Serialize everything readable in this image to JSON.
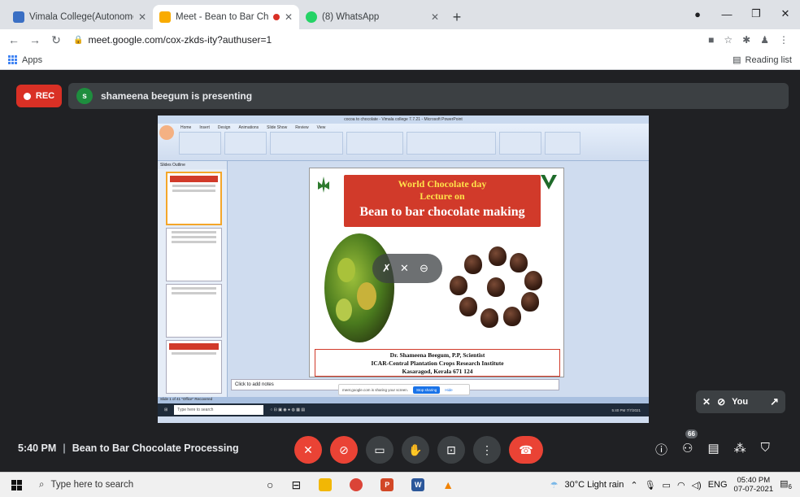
{
  "browser": {
    "tabs": [
      {
        "title": "Vimala College(Autonomous) - C",
        "favicon_color": "#3a6fc4",
        "active": false
      },
      {
        "title": "Meet - Bean to Bar Chocolat",
        "favicon_color": "#f9ab00",
        "active": true
      },
      {
        "title": "(8) WhatsApp",
        "favicon_color": "#25d366",
        "active": false
      }
    ],
    "url": "meet.google.com/cox-zkds-ity?authuser=1",
    "bookmarks": {
      "apps_label": "Apps",
      "reading_list_label": "Reading list"
    }
  },
  "meet": {
    "rec_label": "REC",
    "presenter_initial": "s",
    "presenting_text": "shameena beegum is presenting",
    "self_label": "You",
    "meeting_time": "5:40 PM",
    "meeting_title": "Bean to Bar Chocolate Processing",
    "people_count": "66"
  },
  "shared_screen": {
    "ppt_window_title": "cocoa to chocolate - Vimala college 7.7.21 - Microsoft PowerPoint",
    "ribbon_menu": [
      "Home",
      "Insert",
      "Design",
      "Animations",
      "Slide Show",
      "Review",
      "View"
    ],
    "slides_tabs": "Slides  Outline",
    "slide": {
      "line1": "World Chocolate day",
      "line2": "Lecture on",
      "line3": "Bean to bar chocolate making",
      "credit1": "Dr. Shameena Beegum, P.P, Scientist",
      "credit2": "ICAR-Central Plantation Crops Research Institute",
      "credit3": "Kasaragod, Kerala 671 124"
    },
    "notes_placeholder": "Click to add notes",
    "sharing_text": "meet.google.com is sharing your screen.",
    "stop_sharing": "Stop sharing",
    "hide": "Hide",
    "status_text": "Slide 1 of 41   \"Office\"   Recovered",
    "inner_search": "Type here to search",
    "inner_clock": "5:40 PM 7/7/2021"
  },
  "taskbar": {
    "search_placeholder": "Type here to search",
    "weather": "30°C  Light rain",
    "language": "ENG",
    "time": "05:40 PM",
    "date": "07-07-2021",
    "notification_count": "6"
  }
}
